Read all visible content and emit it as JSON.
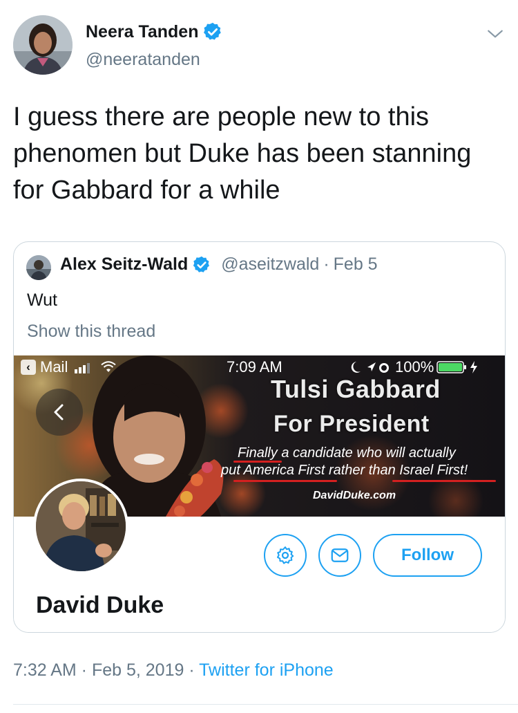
{
  "author": {
    "name": "Neera Tanden",
    "handle": "@neeratanden",
    "avatar_icon": "profile-photo"
  },
  "tweet": {
    "text": "I guess there are people new to this\nphenomen but Duke has been stanning\nfor Gabbard for a while"
  },
  "quoted": {
    "name": "Alex Seitz-Wald",
    "handle": "@aseitzwald",
    "separator": "·",
    "date": "Feb 5",
    "text": "Wut",
    "show_thread": "Show this thread",
    "media": {
      "status_bar": {
        "back_app": "Mail",
        "time": "7:09 AM",
        "battery": "100%"
      },
      "banner": {
        "title_line1": "Tulsi Gabbard",
        "title_line2": "For President",
        "line1": "Finally a candidate who will actually",
        "line2": "put America First rather than Israel First!",
        "site": "DavidDuke.com"
      },
      "profile": {
        "name": "David Duke",
        "follow_label": "Follow"
      }
    }
  },
  "meta": {
    "time": "7:32 AM",
    "sep1": " · ",
    "date": "Feb 5, 2019",
    "sep2": " · ",
    "source": "Twitter for iPhone"
  },
  "colors": {
    "accent": "#1da1f2",
    "secondary_text": "#657786",
    "border": "#ccd6dd"
  }
}
